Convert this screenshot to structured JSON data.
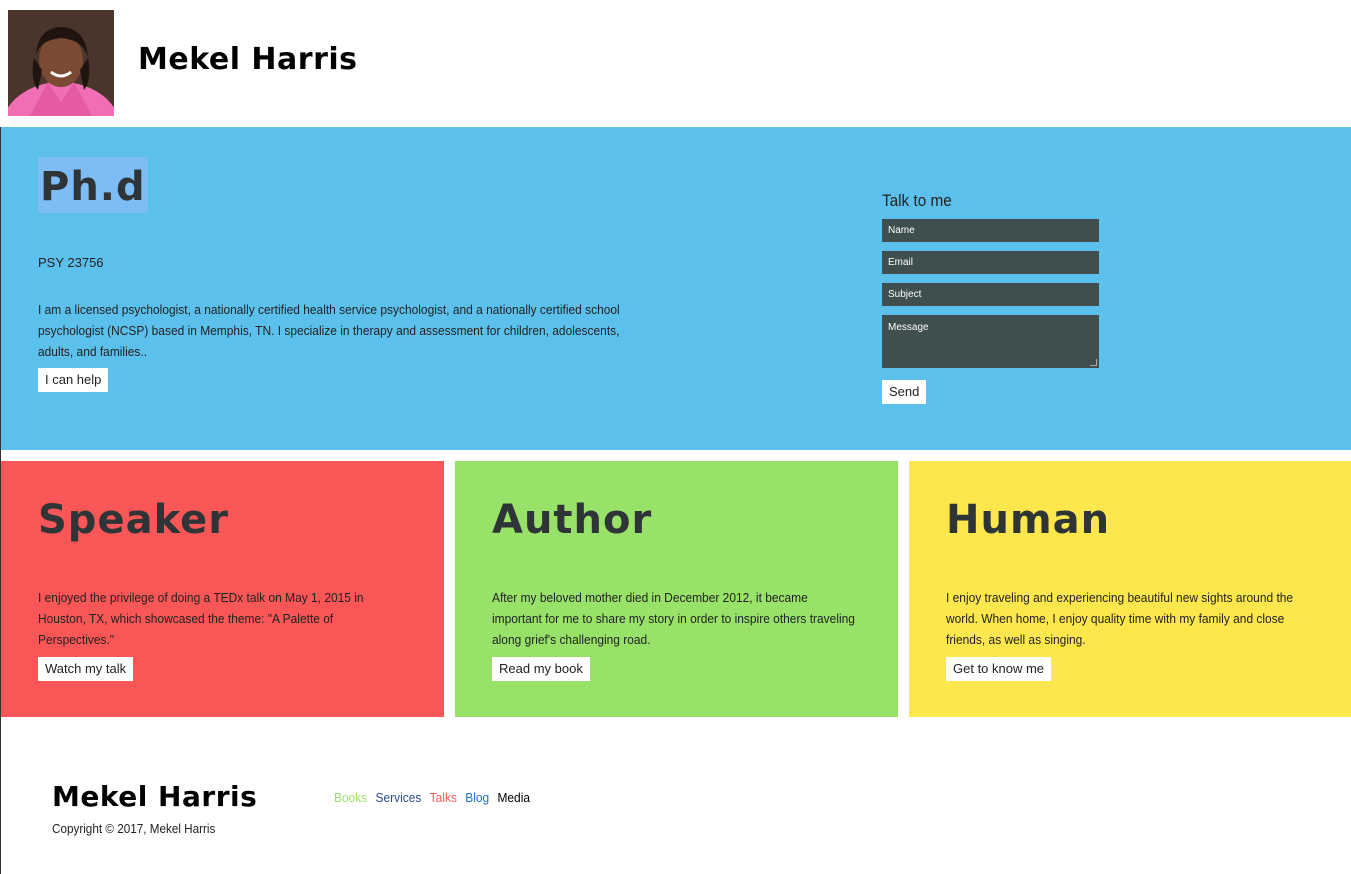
{
  "header": {
    "title": "Mekel Harris"
  },
  "hero": {
    "title": "Ph.d",
    "license": "PSY 23756",
    "bio": "I am a licensed psychologist, a nationally certified health service psychologist, and a nationally certified school psychologist (NCSP) based in Memphis, TN. I specialize in therapy and assessment for children, adolescents, adults, and families..",
    "button_label": "I can help"
  },
  "contact": {
    "title": "Talk to me",
    "name_placeholder": "Name",
    "email_placeholder": "Email",
    "subject_placeholder": "Subject",
    "message_placeholder": "Message",
    "send_label": "Send"
  },
  "cards": [
    {
      "title": "Speaker",
      "text": "I enjoyed the privilege of doing a TEDx talk on May 1, 2015 in Houston, TX, which showcased the theme: \"A Palette of Perspectives.\"",
      "button_label": "Watch my talk",
      "color": "#f95757"
    },
    {
      "title": "Author",
      "text": "After my beloved mother died in December 2012, it became important for me to share my story in order to inspire others traveling along grief's challenging road.",
      "button_label": "Read my book",
      "color": "#98e26a"
    },
    {
      "title": "Human",
      "text": "I enjoy traveling and experiencing beautiful new sights around the world. When home, I enjoy quality time with my family and close friends, as well as singing.",
      "button_label": "Get to know me",
      "color": "#fde74c"
    }
  ],
  "footer": {
    "name": "Mekel Harris",
    "copyright": "Copyright © 2017, Mekel Harris",
    "nav": [
      {
        "label": "Books",
        "color": "#98e26a"
      },
      {
        "label": "Services",
        "color": "#2e4b8f"
      },
      {
        "label": "Talks",
        "color": "#f95757"
      },
      {
        "label": "Blog",
        "color": "#1a73c9"
      },
      {
        "label": "Media",
        "color": "#000000"
      }
    ]
  },
  "colors": {
    "hero_bg": "#5bc0eb",
    "field_bg": "#3f4e4e"
  }
}
